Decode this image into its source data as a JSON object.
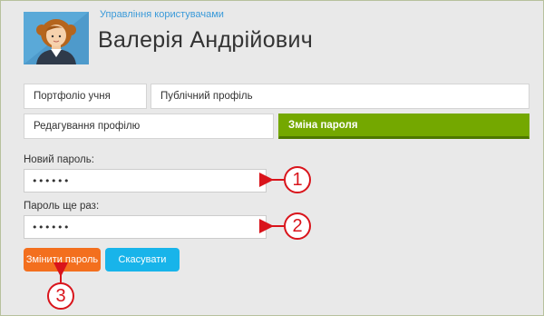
{
  "header": {
    "breadcrumb": "Управління користувачами",
    "title": "Валерія Андрійович"
  },
  "tabs": [
    {
      "label": "Портфоліо учня",
      "active": false
    },
    {
      "label": "Публічний профіль",
      "active": false
    },
    {
      "label": "Редагування профілю",
      "active": false
    },
    {
      "label": "Зміна пароля",
      "active": true
    }
  ],
  "form": {
    "new_password_label": "Новий пароль:",
    "new_password_value": "••••••",
    "repeat_password_label": "Пароль ще раз:",
    "repeat_password_value": "••••••"
  },
  "buttons": {
    "submit_label": "Змінити пароль",
    "cancel_label": "Скасувати"
  },
  "callouts": [
    "1",
    "2",
    "3"
  ],
  "colors": {
    "accent_green": "#74a800",
    "button_orange": "#f36f1e",
    "button_blue": "#18b4ea",
    "link_blue": "#3a9ad9",
    "callout_red": "#d9141b"
  }
}
